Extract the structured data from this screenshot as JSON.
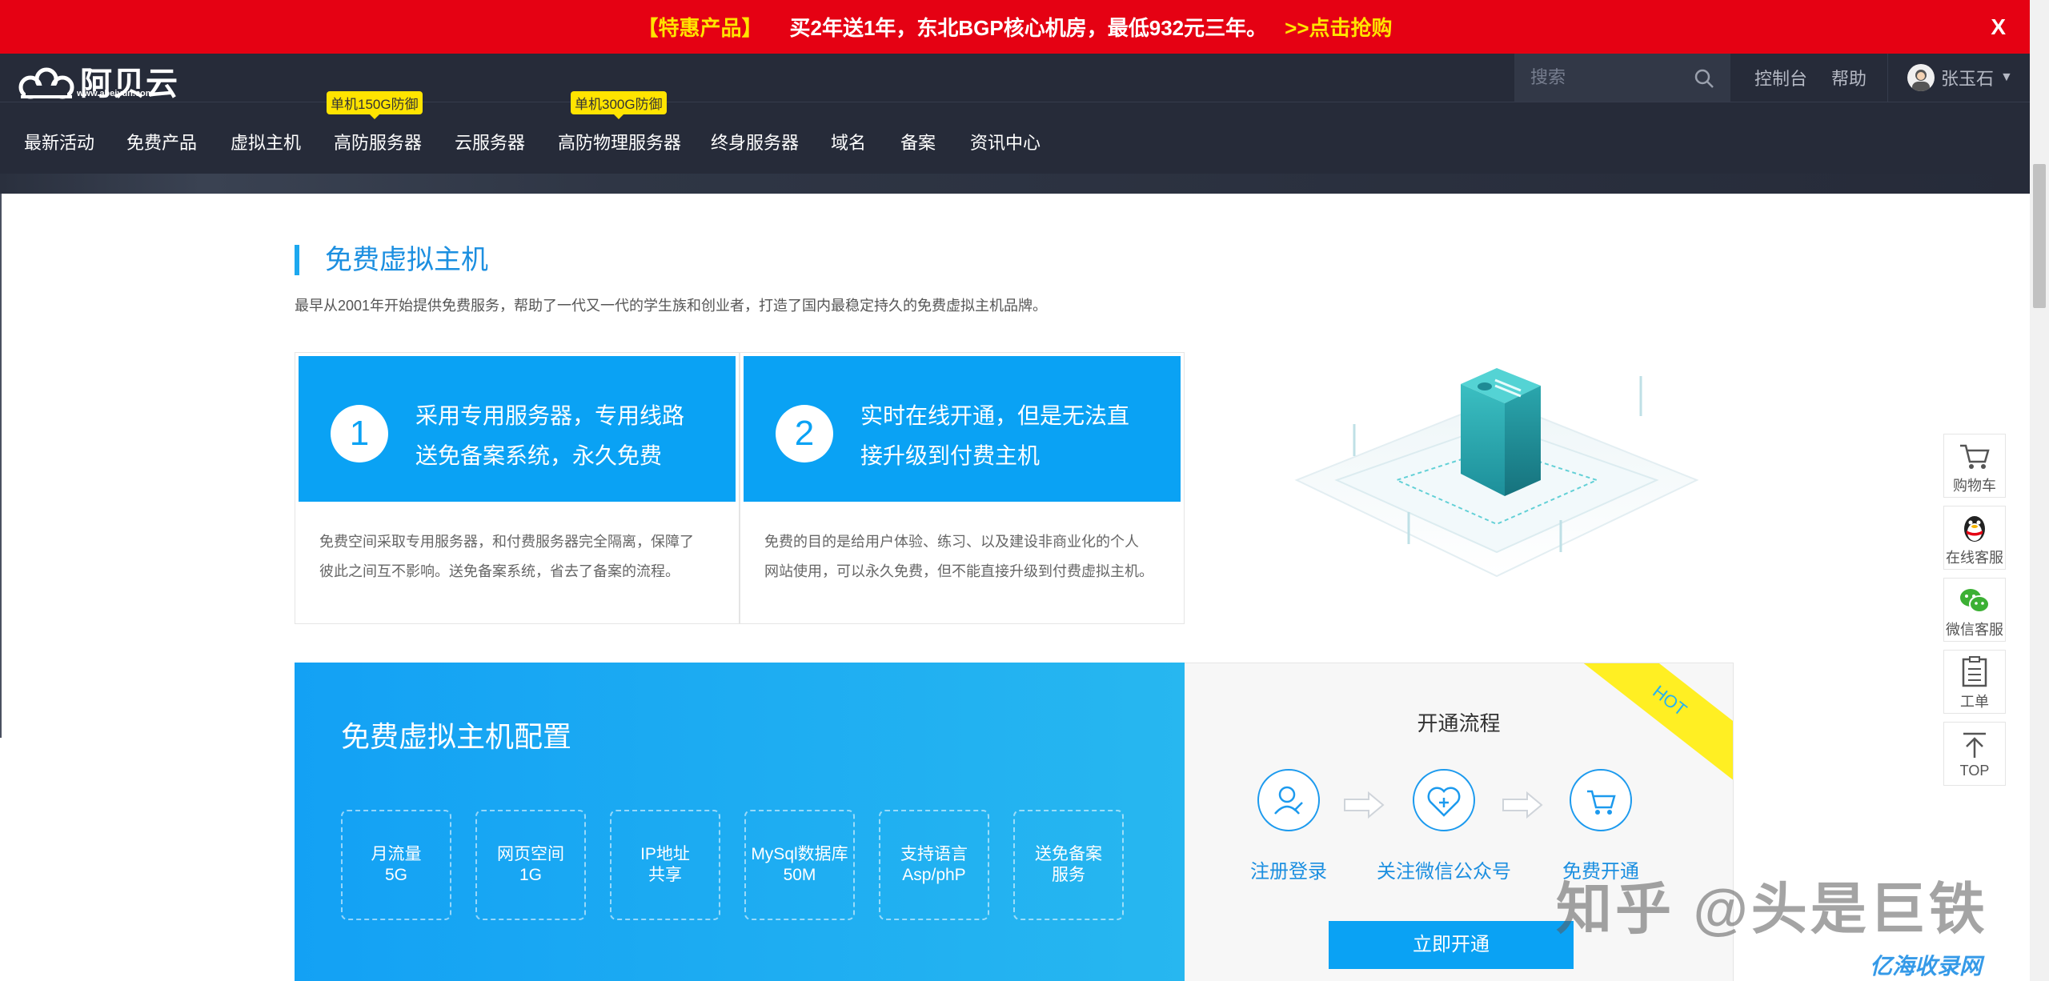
{
  "promo": {
    "tag": "【特惠产品】",
    "text": "买2年送1年，东北BGP核心机房，最低932元三年。",
    "link": ">>点击抢购",
    "close": "X"
  },
  "header": {
    "logo_name": "阿贝云",
    "logo_domain": "www.abeiyun.com",
    "search_placeholder": "搜索",
    "links": [
      "控制台",
      "帮助"
    ],
    "user_name": "张玉石"
  },
  "nav": {
    "items": [
      "最新活动",
      "免费产品",
      "虚拟主机",
      "高防服务器",
      "云服务器",
      "高防物理服务器",
      "终身服务器",
      "域名",
      "备案",
      "资讯中心"
    ],
    "badge_1": "单机150G防御",
    "badge_2": "单机300G防御"
  },
  "section": {
    "title": "免费虚拟主机",
    "subtitle": "最早从2001年开始提供免费服务，帮助了一代又一代的学生族和创业者，打造了国内最稳定持久的免费虚拟主机品牌。"
  },
  "cards": [
    {
      "num": "1",
      "head_line1": "采用专用服务器，专用线路",
      "head_line2": "送免备案系统，永久免费",
      "desc_line1": "免费空间采取专用服务器，和付费服务器完全隔离，保障了",
      "desc_line2": "彼此之间互不影响。送免备案系统，省去了备案的流程。"
    },
    {
      "num": "2",
      "head_line1": "实时在线开通，但是无法直",
      "head_line2": "接升级到付费主机",
      "desc_line1": "免费的目的是给用户体验、练习、以及建设非商业化的个人",
      "desc_line2": "网站使用，可以永久免费，但不能直接升级到付费虚拟主机。"
    }
  ],
  "config": {
    "title": "免费虚拟主机配置",
    "boxes": [
      {
        "l1": "月流量",
        "l2": "5G"
      },
      {
        "l1": "网页空间",
        "l2": "1G"
      },
      {
        "l1": "IP地址",
        "l2": "共享"
      },
      {
        "l1": "MySql数据库",
        "l2": "50M"
      },
      {
        "l1": "支持语言",
        "l2": "Asp/phP"
      },
      {
        "l1": "送免备案",
        "l2": "服务"
      }
    ]
  },
  "process": {
    "title": "开通流程",
    "ribbon": "HOT",
    "steps": [
      "注册登录",
      "关注微信公众号",
      "免费开通"
    ],
    "button": "立即开通"
  },
  "float": [
    "购物车",
    "在线客服",
    "微信客服",
    "工单",
    "TOP"
  ],
  "watermark": {
    "zhihu": "知乎 @头是巨铁",
    "site": "亿海收录网"
  },
  "colors": {
    "promo_red": "#e50113",
    "header_dark": "#262b39",
    "accent_blue": "#0aa2f4",
    "badge_yellow": "#ffe400"
  }
}
